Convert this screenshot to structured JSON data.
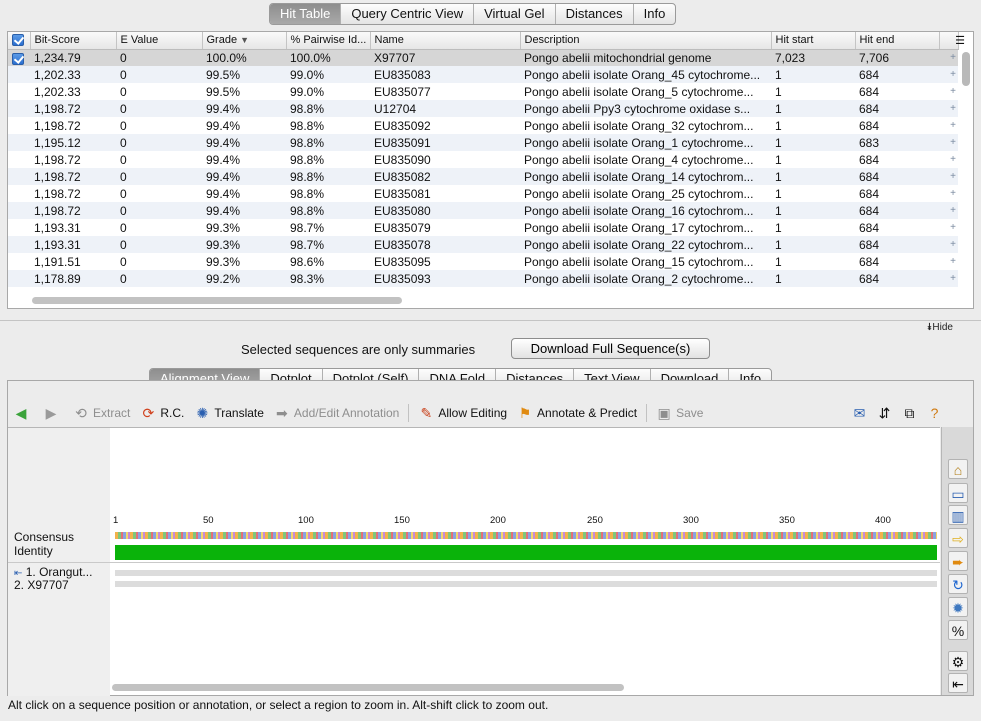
{
  "top_tabs": [
    "Hit Table",
    "Query Centric View",
    "Virtual Gel",
    "Distances",
    "Info"
  ],
  "table": {
    "columns": [
      "Bit-Score",
      "E Value",
      "Grade",
      "% Pairwise Id...",
      "Name",
      "Description",
      "Hit start",
      "Hit end"
    ],
    "sort_indicator": "▼",
    "rows": [
      {
        "checked": true,
        "bit": "1,234.79",
        "e": "0",
        "grade": "100.0%",
        "pid": "100.0%",
        "name": "X97707",
        "desc": "Pongo abelii mitochondrial genome",
        "hstart": "7,023",
        "hend": "7,706"
      },
      {
        "checked": false,
        "bit": "1,202.33",
        "e": "0",
        "grade": "99.5%",
        "pid": "99.0%",
        "name": "EU835083",
        "desc": "Pongo abelii isolate Orang_45 cytochrome...",
        "hstart": "1",
        "hend": "684"
      },
      {
        "checked": false,
        "bit": "1,202.33",
        "e": "0",
        "grade": "99.5%",
        "pid": "99.0%",
        "name": "EU835077",
        "desc": "Pongo abelii isolate Orang_5 cytochrome...",
        "hstart": "1",
        "hend": "684"
      },
      {
        "checked": false,
        "bit": "1,198.72",
        "e": "0",
        "grade": "99.4%",
        "pid": "98.8%",
        "name": "U12704",
        "desc": "Pongo abelii Ppy3 cytochrome oxidase s...",
        "hstart": "1",
        "hend": "684"
      },
      {
        "checked": false,
        "bit": "1,198.72",
        "e": "0",
        "grade": "99.4%",
        "pid": "98.8%",
        "name": "EU835092",
        "desc": "Pongo abelii isolate Orang_32 cytochrom...",
        "hstart": "1",
        "hend": "684"
      },
      {
        "checked": false,
        "bit": "1,195.12",
        "e": "0",
        "grade": "99.4%",
        "pid": "98.8%",
        "name": "EU835091",
        "desc": "Pongo abelii isolate Orang_1 cytochrome...",
        "hstart": "1",
        "hend": "683"
      },
      {
        "checked": false,
        "bit": "1,198.72",
        "e": "0",
        "grade": "99.4%",
        "pid": "98.8%",
        "name": "EU835090",
        "desc": "Pongo abelii isolate Orang_4 cytochrome...",
        "hstart": "1",
        "hend": "684"
      },
      {
        "checked": false,
        "bit": "1,198.72",
        "e": "0",
        "grade": "99.4%",
        "pid": "98.8%",
        "name": "EU835082",
        "desc": "Pongo abelii isolate Orang_14 cytochrom...",
        "hstart": "1",
        "hend": "684"
      },
      {
        "checked": false,
        "bit": "1,198.72",
        "e": "0",
        "grade": "99.4%",
        "pid": "98.8%",
        "name": "EU835081",
        "desc": "Pongo abelii isolate Orang_25 cytochrom...",
        "hstart": "1",
        "hend": "684"
      },
      {
        "checked": false,
        "bit": "1,198.72",
        "e": "0",
        "grade": "99.4%",
        "pid": "98.8%",
        "name": "EU835080",
        "desc": "Pongo abelii isolate Orang_16 cytochrom...",
        "hstart": "1",
        "hend": "684"
      },
      {
        "checked": false,
        "bit": "1,193.31",
        "e": "0",
        "grade": "99.3%",
        "pid": "98.7%",
        "name": "EU835079",
        "desc": "Pongo abelii isolate Orang_17 cytochrom...",
        "hstart": "1",
        "hend": "684"
      },
      {
        "checked": false,
        "bit": "1,193.31",
        "e": "0",
        "grade": "99.3%",
        "pid": "98.7%",
        "name": "EU835078",
        "desc": "Pongo abelii isolate Orang_22 cytochrom...",
        "hstart": "1",
        "hend": "684"
      },
      {
        "checked": false,
        "bit": "1,191.51",
        "e": "0",
        "grade": "99.3%",
        "pid": "98.6%",
        "name": "EU835095",
        "desc": "Pongo abelii isolate Orang_15 cytochrom...",
        "hstart": "1",
        "hend": "684"
      },
      {
        "checked": false,
        "bit": "1,178.89",
        "e": "0",
        "grade": "99.2%",
        "pid": "98.3%",
        "name": "EU835093",
        "desc": "Pongo abelii isolate Orang_2 cytochrome...",
        "hstart": "1",
        "hend": "684"
      }
    ]
  },
  "hide_label": "Hide",
  "summary_note": "Selected sequences are only summaries",
  "download_full_label": "Download Full Sequence(s)",
  "bottom_tabs": [
    "Alignment View",
    "Dotplot",
    "Dotplot (Self)",
    "DNA Fold",
    "Distances",
    "Text View",
    "Download",
    "Info"
  ],
  "toolbar": {
    "extract": "Extract",
    "rc": "R.C.",
    "translate": "Translate",
    "add_annotation": "Add/Edit Annotation",
    "allow_editing": "Allow Editing",
    "annotate_predict": "Annotate & Predict",
    "save": "Save"
  },
  "viewer": {
    "ruler_ticks": [
      "1",
      "50",
      "100",
      "150",
      "200",
      "250",
      "300",
      "350",
      "400"
    ],
    "consensus_label": "Consensus",
    "identity_label": "Identity",
    "seq1": "1. Orangut...",
    "seq2": "2. X97707"
  },
  "status": "Alt click on a sequence position or annotation, or select a region to zoom in. Alt-shift click to zoom out.",
  "colors": {
    "identity": "#0ab30a",
    "selected_row": "#d6d6d6"
  }
}
